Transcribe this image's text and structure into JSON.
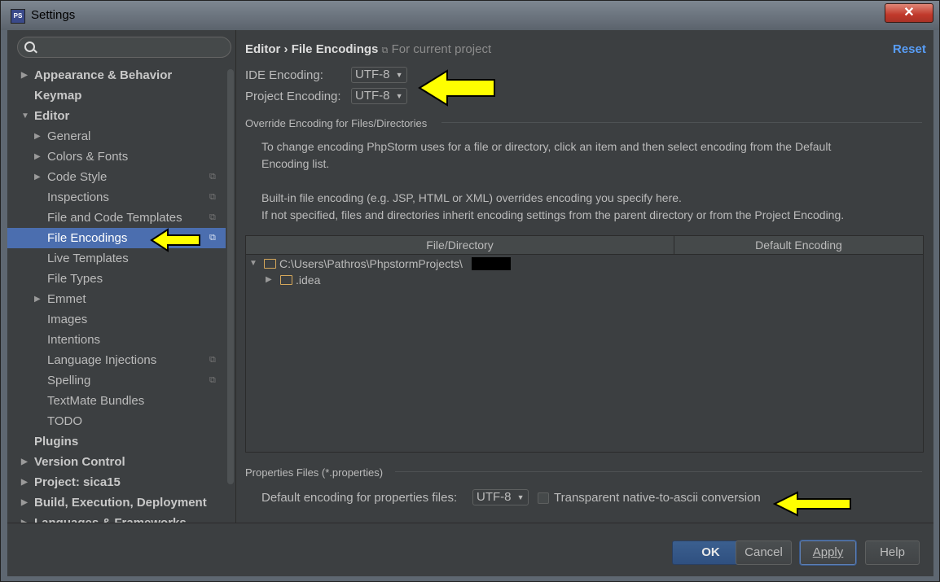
{
  "window": {
    "title": "Settings",
    "close_symbol": "✕",
    "app_icon_text": "PS"
  },
  "search": {
    "placeholder": ""
  },
  "sidebar": {
    "items": [
      {
        "label": "Appearance & Behavior",
        "bold": true,
        "arrow": "right",
        "level": 0
      },
      {
        "label": "Keymap",
        "bold": true,
        "arrow": "none",
        "level": 0
      },
      {
        "label": "Editor",
        "bold": true,
        "arrow": "down",
        "level": 0
      },
      {
        "label": "General",
        "bold": false,
        "arrow": "right",
        "level": 1
      },
      {
        "label": "Colors & Fonts",
        "bold": false,
        "arrow": "right",
        "level": 1
      },
      {
        "label": "Code Style",
        "bold": false,
        "arrow": "right",
        "level": 1,
        "scope_icon": true
      },
      {
        "label": "Inspections",
        "bold": false,
        "arrow": "none",
        "level": 1,
        "scope_icon": true
      },
      {
        "label": "File and Code Templates",
        "bold": false,
        "arrow": "none",
        "level": 1,
        "scope_icon": true
      },
      {
        "label": "File Encodings",
        "bold": false,
        "arrow": "none",
        "level": 1,
        "scope_icon": true,
        "selected": true
      },
      {
        "label": "Live Templates",
        "bold": false,
        "arrow": "none",
        "level": 1
      },
      {
        "label": "File Types",
        "bold": false,
        "arrow": "none",
        "level": 1
      },
      {
        "label": "Emmet",
        "bold": false,
        "arrow": "right",
        "level": 1
      },
      {
        "label": "Images",
        "bold": false,
        "arrow": "none",
        "level": 1
      },
      {
        "label": "Intentions",
        "bold": false,
        "arrow": "none",
        "level": 1
      },
      {
        "label": "Language Injections",
        "bold": false,
        "arrow": "none",
        "level": 1,
        "scope_icon": true
      },
      {
        "label": "Spelling",
        "bold": false,
        "arrow": "none",
        "level": 1,
        "scope_icon": true
      },
      {
        "label": "TextMate Bundles",
        "bold": false,
        "arrow": "none",
        "level": 1
      },
      {
        "label": "TODO",
        "bold": false,
        "arrow": "none",
        "level": 1
      },
      {
        "label": "Plugins",
        "bold": true,
        "arrow": "none",
        "level": 0
      },
      {
        "label": "Version Control",
        "bold": true,
        "arrow": "right",
        "level": 0
      },
      {
        "label": "Project: sica15",
        "bold": true,
        "arrow": "right",
        "level": 0
      },
      {
        "label": "Build, Execution, Deployment",
        "bold": true,
        "arrow": "right",
        "level": 0
      },
      {
        "label": "Languages & Frameworks",
        "bold": true,
        "arrow": "right",
        "level": 0
      }
    ]
  },
  "header": {
    "section": "Editor",
    "separator": "›",
    "page": "File Encodings",
    "scope_label": "For current project",
    "reset_label": "Reset"
  },
  "encoding": {
    "ide_label": "IDE Encoding:",
    "ide_value": "UTF-8",
    "project_label": "Project Encoding:",
    "project_value": "UTF-8"
  },
  "override": {
    "title": "Override Encoding for Files/Directories",
    "info_line1": "To change encoding PhpStorm uses for a file or directory, click an item and then select encoding from the Default",
    "info_line2": "Encoding list.",
    "info_line3": "Built-in file encoding (e.g. JSP, HTML or XML) overrides encoding you specify here.",
    "info_line4": "If not specified, files and directories inherit encoding settings from the parent directory or from the Project Encoding.",
    "columns": [
      "File/Directory",
      "Default Encoding"
    ],
    "rows": [
      {
        "path": "C:\\Users\\Pathros\\PhpstormProjects\\",
        "expanded": true,
        "redacted_suffix": true
      },
      {
        "path": ".idea",
        "expanded": false
      }
    ]
  },
  "properties": {
    "title": "Properties Files (*.properties)",
    "default_label": "Default encoding for properties files:",
    "default_value": "UTF-8",
    "transparent_label": "Transparent native-to-ascii conversion",
    "transparent_checked": false
  },
  "footer": {
    "ok_label": "OK",
    "cancel_label": "Cancel",
    "apply_label": "Apply",
    "help_label": "Help"
  },
  "colors": {
    "accent": "#4b6eaf",
    "link": "#589df6",
    "annotation_arrow": "#ffff00"
  }
}
